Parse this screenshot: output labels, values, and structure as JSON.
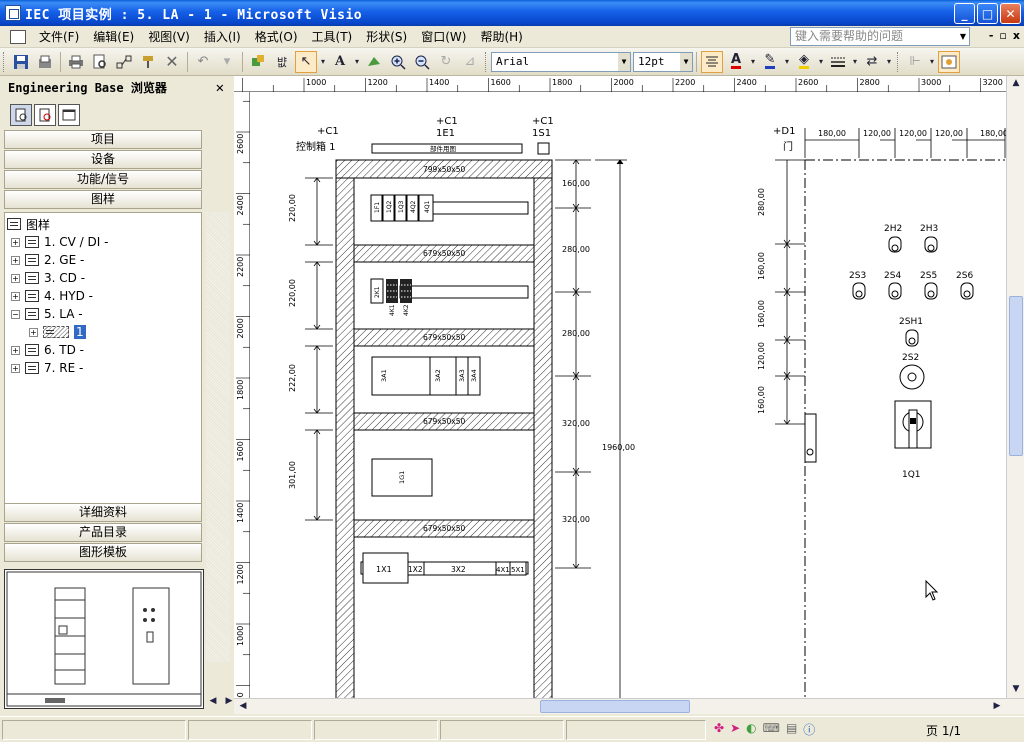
{
  "window": {
    "title": "IEC 项目实例 : 5. LA - 1 - Microsoft Visio",
    "minimize": "_",
    "maximize": "□",
    "close": "✕"
  },
  "menubar": {
    "items": [
      "文件(F)",
      "编辑(E)",
      "视图(V)",
      "插入(I)",
      "格式(O)",
      "工具(T)",
      "形状(S)",
      "窗口(W)",
      "帮助(H)"
    ],
    "help_placeholder": "键入需要帮助的问题",
    "mdi_minimize": "-",
    "mdi_restore": "▫",
    "mdi_close": "x"
  },
  "toolbar": {
    "font_name": "Arial",
    "font_size": "12pt",
    "icons": [
      "save-icon",
      "print-icon",
      "print-preview-icon",
      "connector-icon",
      "delete-icon",
      "undo-icon",
      "redo-icon",
      "pointer-icon",
      "text-icon",
      "zoom-in-icon",
      "zoom-out-icon"
    ]
  },
  "left_panel": {
    "title": "Engineering Base 浏览器",
    "close": "✕",
    "tabs_top": [
      "项目",
      "设备",
      "功能/信号",
      "图样"
    ],
    "tabs_bottom": [
      "详细资料",
      "产品目录",
      "图形模板"
    ],
    "tree": {
      "root": "图样",
      "items": [
        {
          "label": "1. CV / DI -",
          "expander": "+"
        },
        {
          "label": "2. GE -",
          "expander": "+"
        },
        {
          "label": "3. CD -",
          "expander": "+"
        },
        {
          "label": "4. HYD -",
          "expander": "+"
        },
        {
          "label": "5. LA -",
          "expander": "−"
        },
        {
          "label": "6. TD -",
          "expander": "+"
        },
        {
          "label": "7. RE -",
          "expander": "+"
        }
      ],
      "child_label": "1",
      "child_expander": "+"
    }
  },
  "ruler": {
    "top_labels": [
      "1000",
      "1200",
      "1400",
      "1600",
      "1800",
      "2000",
      "2200",
      "2400",
      "2600",
      "2800",
      "3000",
      "3200"
    ],
    "left_labels": [
      "2600",
      "2400",
      "2200",
      "2000",
      "1800",
      "1600",
      "1400",
      "1200",
      "1000",
      "800"
    ]
  },
  "drawing": {
    "cabinet": {
      "loc": "+C1",
      "name": "控制箱 1",
      "top_loc": "+C1",
      "top_id": "1E1",
      "top_part": "部件用图",
      "switch_loc": "+C1",
      "switch_id": "1S1",
      "rails": [
        "799x50x50",
        "679x50x50",
        "679x50x50",
        "679x50x50",
        "679x50x50"
      ],
      "left_dims": [
        "220,00",
        "220,00",
        "222,00",
        "301,00"
      ],
      "right_dims": [
        "160,00",
        "280,00",
        "280,00",
        "320,00",
        "320,00"
      ],
      "total_height": "1960,00",
      "row1_devices": [
        "1F1",
        "1Q2",
        "1Q3",
        "4Q2",
        "4Q1"
      ],
      "row2_devices": [
        "2K1",
        "4K1",
        "4K2"
      ],
      "row3_devices": [
        "3A1",
        "3A2",
        "3A3",
        "3A4"
      ],
      "row4_devices": [
        "1G1"
      ],
      "row5_devices": [
        "1X1",
        "1X2",
        "3X2",
        "4X1",
        "5X1"
      ]
    },
    "door": {
      "loc": "+D1",
      "name": "门",
      "top_dims": [
        "180,00",
        "120,00",
        "120,00",
        "120,00",
        "180,00"
      ],
      "left_dims": [
        "280,00",
        "160,00",
        "160,00",
        "120,00",
        "160,00"
      ],
      "lamps_top": [
        "2H2",
        "2H3"
      ],
      "lamps": [
        "2S3",
        "2S4",
        "2S5",
        "2S6"
      ],
      "sh": "2SH1",
      "s2": "2S2",
      "main_switch": "1Q1"
    }
  },
  "status": {
    "page": "页 1/1"
  }
}
